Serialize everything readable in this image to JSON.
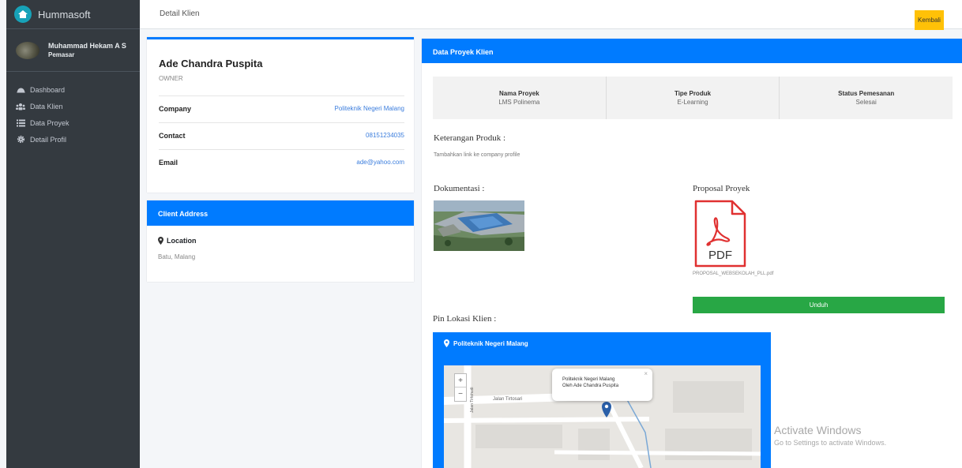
{
  "sidebar": {
    "brand": "Hummasoft",
    "user": {
      "name": "Muhammad Hekam A S",
      "role": "Pemasar"
    },
    "items": [
      {
        "label": "Dashboard",
        "icon": "dashboard-icon"
      },
      {
        "label": "Data Klien",
        "icon": "users-icon"
      },
      {
        "label": "Data Proyek",
        "icon": "list-icon"
      },
      {
        "label": "Detail Profil",
        "icon": "gear-icon"
      }
    ]
  },
  "header": {
    "title": "Detail Klien",
    "back_label": "Kembali"
  },
  "client": {
    "name": "Ade Chandra Puspita",
    "role": "OWNER",
    "fields": [
      {
        "label": "Company",
        "value": "Politeknik Negeri Malang"
      },
      {
        "label": "Contact",
        "value": "08151234035"
      },
      {
        "label": "Email",
        "value": "ade@yahoo.com"
      }
    ]
  },
  "address": {
    "header": "Client Address",
    "location_label": "Location",
    "location_value": "Batu, Malang"
  },
  "project": {
    "header": "Data Proyek Klien",
    "summary": [
      {
        "label": "Nama Proyek",
        "value": "LMS Polinema"
      },
      {
        "label": "Tipe Produk",
        "value": "E-Learning"
      },
      {
        "label": "Status Pemesanan",
        "value": "Selesai"
      }
    ],
    "keterangan_title": "Keterangan Produk :",
    "keterangan_text": "Tambahkan link ke company profile",
    "dokumentasi_title": "Dokumentasi :",
    "proposal_title": "Proposal Proyek",
    "pdf_label": "PDF",
    "pdf_filename": "PROPOSAL_WEBSEKOLAH_PLL.pdf",
    "unduh_label": "Unduh",
    "pin_title": "Pin Lokasi Klien :"
  },
  "map": {
    "title": "Politeknik Negeri Malang",
    "street": "Jalan Tirtosari",
    "street2": "Jalan Tirtohudi",
    "popup_line1": "Politeknik Negeri Malang",
    "popup_line2": "Oleh Ade Chandra Puspita",
    "zoom_in": "+",
    "zoom_out": "−",
    "close": "×"
  },
  "watermark": {
    "title": "Activate Windows",
    "subtitle": "Go to Settings to activate Windows."
  },
  "colors": {
    "primary": "#007bff",
    "success": "#28a745",
    "warning": "#ffc107",
    "sidebar": "#343a40"
  }
}
